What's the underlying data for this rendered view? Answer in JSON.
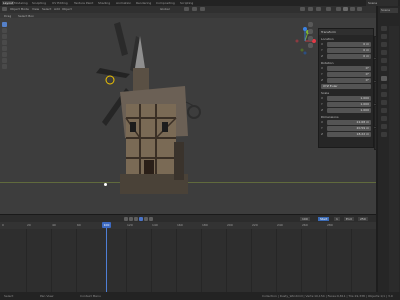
{
  "topbar": {
    "workspaces": [
      "Layout",
      "Modeling",
      "Sculpting",
      "UV Editing",
      "Texture Paint",
      "Shading",
      "Animation",
      "Rendering",
      "Compositing",
      "Scripting"
    ],
    "active_workspace": "Layout",
    "scene": "Scene"
  },
  "viewport_header": {
    "mode": "Object Mode",
    "view": "View",
    "select": "Select",
    "add": "Add",
    "object": "Object",
    "orientation": "Global",
    "transform_pivot": "Default",
    "snap_label": "Drag",
    "select_box": "Select Box"
  },
  "npanel": {
    "title": "Transform",
    "location_label": "Location",
    "location": [
      "0 m",
      "0 m",
      "0 m"
    ],
    "rotation_label": "Rotation",
    "rotation": [
      "0°",
      "0°",
      "0°"
    ],
    "rotation_mode": "XYZ Euler",
    "scale_label": "Scale",
    "scale": [
      "1.000",
      "1.000",
      "1.000"
    ],
    "dimensions_label": "Dimensions",
    "dimensions": [
      "22.68 m",
      "20.59 m",
      "18.22 m"
    ],
    "axes": [
      "X",
      "Y",
      "Z"
    ]
  },
  "gizmo": {
    "x": "X",
    "y": "Y",
    "z": "Z"
  },
  "timeline": {
    "current_frame": "100",
    "start_label": "Start",
    "start": "1",
    "end_label": "End",
    "end": "250",
    "frame_field": "100",
    "ticks": [
      "0",
      "20",
      "40",
      "60",
      "80",
      "100",
      "120",
      "140",
      "160",
      "180",
      "200",
      "220",
      "240",
      "260",
      "280"
    ]
  },
  "status": {
    "left": "Select",
    "center": "Pan View",
    "right": "Context Menu",
    "stats": "Collection | Rusty_Windmill | Verts:10,154 | Faces:9,811 | Tris:19,338 | Objects:1/1 | 3.0"
  },
  "properties": {
    "header": "Scene"
  },
  "colors": {
    "viewport_bg": "#3d3d3d",
    "accent_blue": "#4a74c9",
    "axis_x": "#e23a47",
    "axis_y": "#7fb731",
    "axis_z": "#3b82e3",
    "gizmo_highlight": "#f0c400"
  }
}
